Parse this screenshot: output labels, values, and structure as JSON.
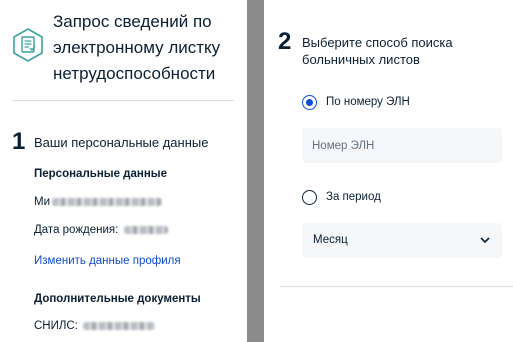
{
  "service": {
    "icon": "document-icon",
    "title": "Запрос сведений по электронному листку нетрудоспособности"
  },
  "step1": {
    "number": "1",
    "title": "Ваши персональные данные",
    "personal_heading": "Персональные данные",
    "name_prefix": "Ми",
    "birth_label": "Дата рождения:",
    "edit_profile_link": "Изменить данные профиля",
    "extra_docs_heading": "Дополнительные документы",
    "snils_label": "СНИЛС:"
  },
  "step2": {
    "number": "2",
    "title": "Выберите способ поиска больничных листов",
    "option_eln_label": "По номеру ЭЛН",
    "option_eln_selected": true,
    "eln_placeholder": "Номер ЭЛН",
    "option_period_label": "За период",
    "option_period_selected": false,
    "period_select_value": "Месяц"
  },
  "colors": {
    "accent": "#0d4cd3",
    "text": "#0b1f33",
    "field_bg": "#f5f7fa",
    "icon_teal": "#3aa3a0"
  }
}
